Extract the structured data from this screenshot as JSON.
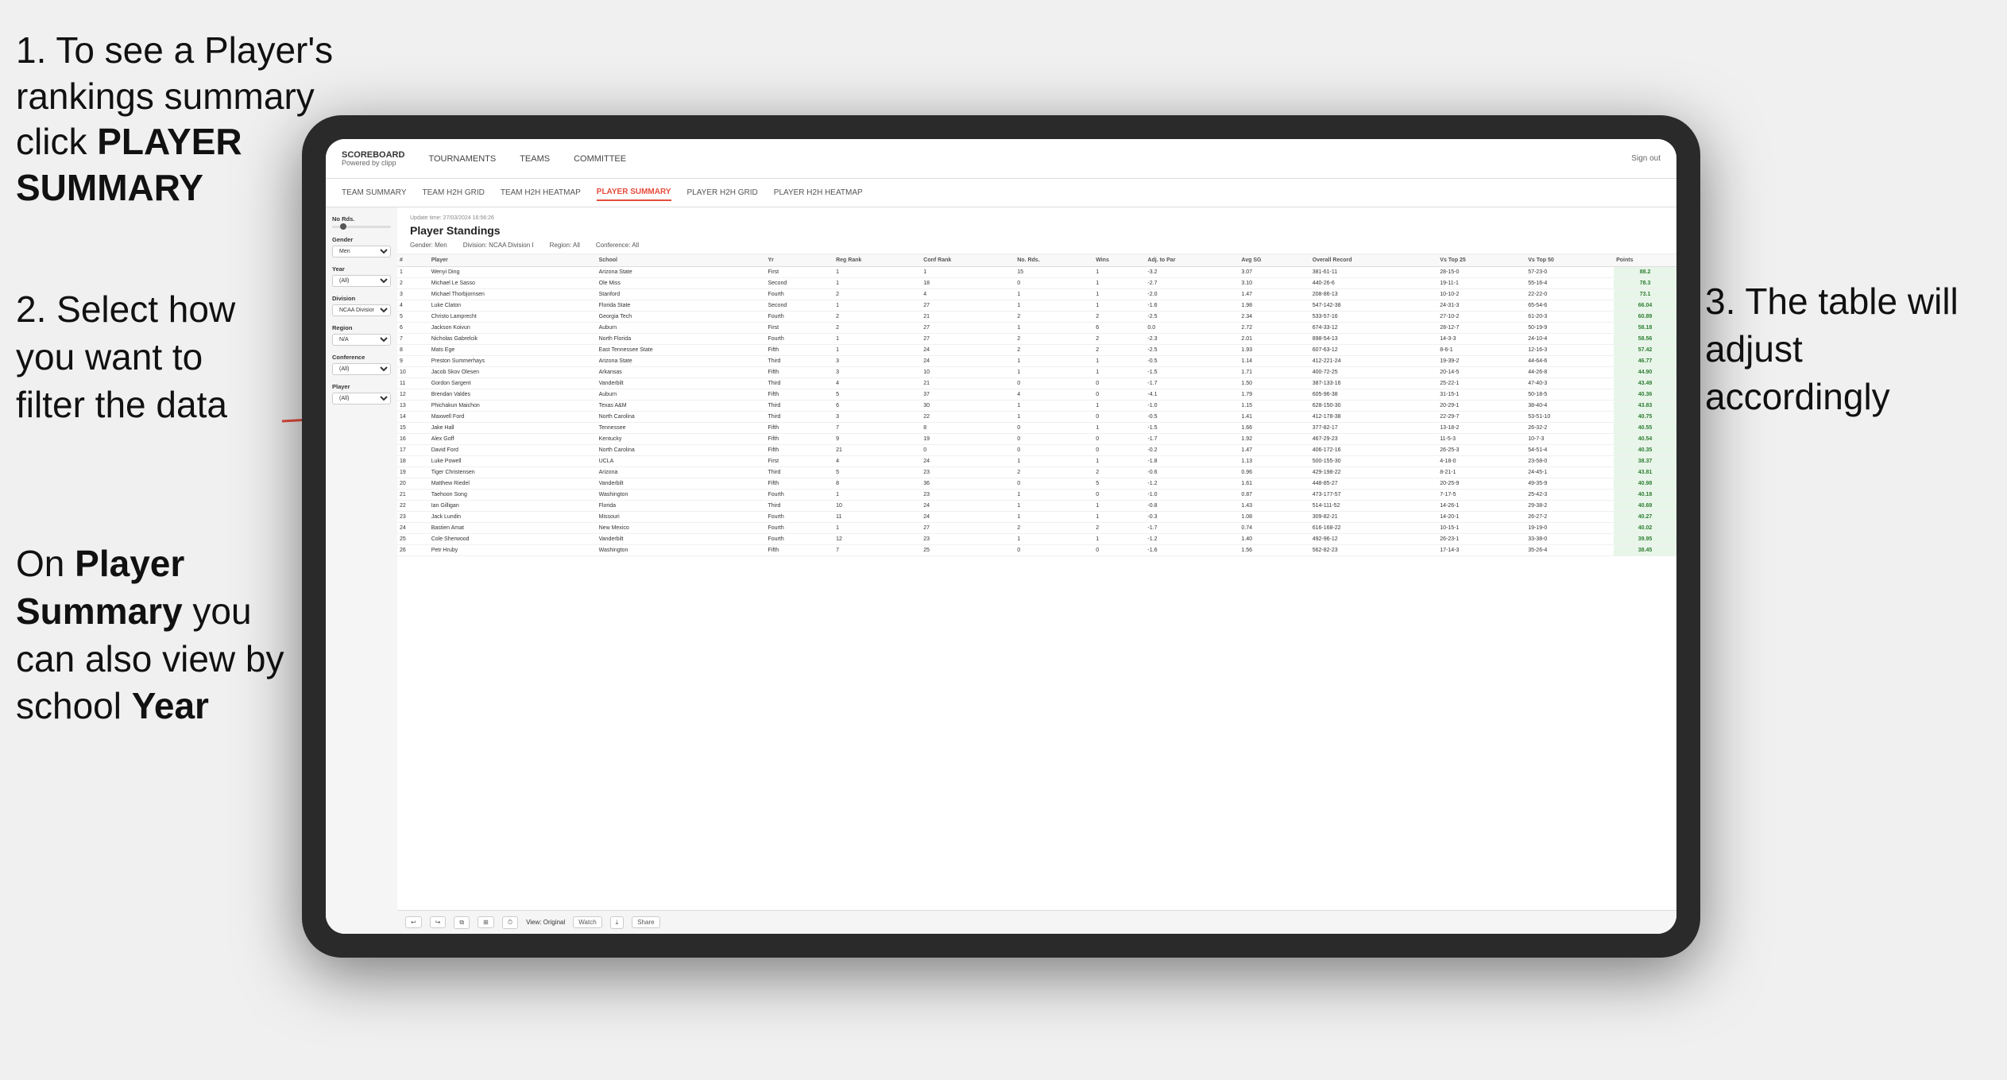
{
  "instructions": {
    "step1": "1. To see a Player's rankings summary click ",
    "step1_bold": "PLAYER SUMMARY",
    "step2_line1": "2. Select how you want to",
    "step2_line2": "filter the data",
    "step3_line1": "On ",
    "step3_bold1": "Player",
    "step3_line2": "Summary",
    "step3_line3": " you can also view by school ",
    "step3_bold2": "Year",
    "step4": "3. The table will adjust accordingly"
  },
  "header": {
    "logo": "SCOREBOARD",
    "logo_sub": "Powered by clipp",
    "nav": [
      "TOURNAMENTS",
      "TEAMS",
      "COMMITTEE"
    ],
    "sign_out": "Sign out"
  },
  "sub_nav": {
    "items": [
      "TEAM SUMMARY",
      "TEAM H2H GRID",
      "TEAM H2H HEATMAP",
      "PLAYER SUMMARY",
      "PLAYER H2H GRID",
      "PLAYER H2H HEATMAP"
    ],
    "active": "PLAYER SUMMARY"
  },
  "filters": {
    "no_rds_label": "No Rds.",
    "gender_label": "Gender",
    "gender_value": "Men",
    "year_label": "Year",
    "year_value": "(All)",
    "division_label": "Division",
    "division_value": "NCAA Division I",
    "region_label": "Region",
    "region_value": "N/A",
    "conference_label": "Conference",
    "conference_value": "(All)",
    "player_label": "Player",
    "player_value": "(All)"
  },
  "table": {
    "update_time": "Update time:",
    "update_date": "27/03/2024 16:56:26",
    "title": "Player Standings",
    "gender_label": "Gender:",
    "gender_val": "Men",
    "division_label": "Division:",
    "division_val": "NCAA Division I",
    "region_label": "Region:",
    "region_val": "All",
    "conference_label": "Conference:",
    "conference_val": "All",
    "columns": [
      "#",
      "Player",
      "School",
      "Yr",
      "Reg Rank",
      "Conf Rank",
      "No. Rds.",
      "Wins",
      "Adj. to Par",
      "Avg SG",
      "Overall Record",
      "Vs Top 25",
      "Vs Top 50",
      "Points"
    ],
    "rows": [
      {
        "rank": "1",
        "player": "Wenyi Ding",
        "school": "Arizona State",
        "yr": "First",
        "reg_rank": "1",
        "conf_rank": "1",
        "rds": "15",
        "wins": "1",
        "adj": "-3.2",
        "avg": "3.07",
        "record": "381-61-11",
        "vt25": "28-15-0",
        "vt50": "57-23-0",
        "points": "88.2"
      },
      {
        "rank": "2",
        "player": "Michael Le Sasso",
        "school": "Ole Miss",
        "yr": "Second",
        "reg_rank": "1",
        "conf_rank": "18",
        "rds": "0",
        "wins": "1",
        "adj": "-2.7",
        "avg": "3.10",
        "record": "440-26-6",
        "vt25": "19-11-1",
        "vt50": "55-16-4",
        "points": "78.3"
      },
      {
        "rank": "3",
        "player": "Michael Thorbjornsen",
        "school": "Stanford",
        "yr": "Fourth",
        "reg_rank": "2",
        "conf_rank": "4",
        "rds": "1",
        "wins": "1",
        "adj": "-2.0",
        "avg": "1.47",
        "record": "208-86-13",
        "vt25": "10-10-2",
        "vt50": "22-22-0",
        "points": "73.1"
      },
      {
        "rank": "4",
        "player": "Luke Claton",
        "school": "Florida State",
        "yr": "Second",
        "reg_rank": "1",
        "conf_rank": "27",
        "rds": "1",
        "wins": "1",
        "adj": "-1.6",
        "avg": "1.98",
        "record": "547-142-38",
        "vt25": "24-31-3",
        "vt50": "65-54-6",
        "points": "66.04"
      },
      {
        "rank": "5",
        "player": "Christo Lamprecht",
        "school": "Georgia Tech",
        "yr": "Fourth",
        "reg_rank": "2",
        "conf_rank": "21",
        "rds": "2",
        "wins": "2",
        "adj": "-2.5",
        "avg": "2.34",
        "record": "533-57-16",
        "vt25": "27-10-2",
        "vt50": "61-20-3",
        "points": "60.89"
      },
      {
        "rank": "6",
        "player": "Jackson Koivun",
        "school": "Auburn",
        "yr": "First",
        "reg_rank": "2",
        "conf_rank": "27",
        "rds": "1",
        "wins": "6",
        "adj": "0.0",
        "avg": "2.72",
        "record": "674-33-12",
        "vt25": "28-12-7",
        "vt50": "50-19-9",
        "points": "58.18"
      },
      {
        "rank": "7",
        "player": "Nicholas Gabrelcik",
        "school": "North Florida",
        "yr": "Fourth",
        "reg_rank": "1",
        "conf_rank": "27",
        "rds": "2",
        "wins": "2",
        "adj": "-2.3",
        "avg": "2.01",
        "record": "898-54-13",
        "vt25": "14-3-3",
        "vt50": "24-10-4",
        "points": "58.56"
      },
      {
        "rank": "8",
        "player": "Mats Ege",
        "school": "East Tennessee State",
        "yr": "Fifth",
        "reg_rank": "1",
        "conf_rank": "24",
        "rds": "2",
        "wins": "2",
        "adj": "-2.5",
        "avg": "1.93",
        "record": "607-63-12",
        "vt25": "8-6-1",
        "vt50": "12-16-3",
        "points": "57.42"
      },
      {
        "rank": "9",
        "player": "Preston Summerhays",
        "school": "Arizona State",
        "yr": "Third",
        "reg_rank": "3",
        "conf_rank": "24",
        "rds": "1",
        "wins": "1",
        "adj": "-0.5",
        "avg": "1.14",
        "record": "412-221-24",
        "vt25": "19-39-2",
        "vt50": "44-64-6",
        "points": "46.77"
      },
      {
        "rank": "10",
        "player": "Jacob Skov Olesen",
        "school": "Arkansas",
        "yr": "Fifth",
        "reg_rank": "3",
        "conf_rank": "10",
        "rds": "1",
        "wins": "1",
        "adj": "-1.5",
        "avg": "1.71",
        "record": "400-72-25",
        "vt25": "20-14-5",
        "vt50": "44-26-8",
        "points": "44.90"
      },
      {
        "rank": "11",
        "player": "Gordon Sargent",
        "school": "Vanderbilt",
        "yr": "Third",
        "reg_rank": "4",
        "conf_rank": "21",
        "rds": "0",
        "wins": "0",
        "adj": "-1.7",
        "avg": "1.50",
        "record": "387-133-16",
        "vt25": "25-22-1",
        "vt50": "47-40-3",
        "points": "43.49"
      },
      {
        "rank": "12",
        "player": "Brendan Valdes",
        "school": "Auburn",
        "yr": "Fifth",
        "reg_rank": "5",
        "conf_rank": "37",
        "rds": "4",
        "wins": "0",
        "adj": "-4.1",
        "avg": "1.79",
        "record": "605-96-38",
        "vt25": "31-15-1",
        "vt50": "50-18-5",
        "points": "40.36"
      },
      {
        "rank": "13",
        "player": "Phichakun Maichon",
        "school": "Texas A&M",
        "yr": "Third",
        "reg_rank": "6",
        "conf_rank": "30",
        "rds": "1",
        "wins": "1",
        "adj": "-1.0",
        "avg": "1.15",
        "record": "628-150-30",
        "vt25": "20-29-1",
        "vt50": "38-40-4",
        "points": "43.83"
      },
      {
        "rank": "14",
        "player": "Maxwell Ford",
        "school": "North Carolina",
        "yr": "Third",
        "reg_rank": "3",
        "conf_rank": "22",
        "rds": "1",
        "wins": "0",
        "adj": "-0.5",
        "avg": "1.41",
        "record": "412-178-38",
        "vt25": "22-29-7",
        "vt50": "53-51-10",
        "points": "40.75"
      },
      {
        "rank": "15",
        "player": "Jake Hall",
        "school": "Tennessee",
        "yr": "Fifth",
        "reg_rank": "7",
        "conf_rank": "8",
        "rds": "0",
        "wins": "1",
        "adj": "-1.5",
        "avg": "1.66",
        "record": "377-82-17",
        "vt25": "13-18-2",
        "vt50": "26-32-2",
        "points": "40.55"
      },
      {
        "rank": "16",
        "player": "Alex Goff",
        "school": "Kentucky",
        "yr": "Fifth",
        "reg_rank": "9",
        "conf_rank": "19",
        "rds": "0",
        "wins": "0",
        "adj": "-1.7",
        "avg": "1.92",
        "record": "467-29-23",
        "vt25": "11-5-3",
        "vt50": "10-7-3",
        "points": "40.54"
      },
      {
        "rank": "17",
        "player": "David Ford",
        "school": "North Carolina",
        "yr": "Fifth",
        "reg_rank": "21",
        "conf_rank": "0",
        "rds": "0",
        "wins": "0",
        "adj": "-0.2",
        "avg": "1.47",
        "record": "406-172-16",
        "vt25": "26-25-3",
        "vt50": "54-51-4",
        "points": "40.35"
      },
      {
        "rank": "18",
        "player": "Luke Powell",
        "school": "UCLA",
        "yr": "First",
        "reg_rank": "4",
        "conf_rank": "24",
        "rds": "1",
        "wins": "1",
        "adj": "-1.8",
        "avg": "1.13",
        "record": "500-155-30",
        "vt25": "4-18-0",
        "vt50": "23-58-0",
        "points": "38.37"
      },
      {
        "rank": "19",
        "player": "Tiger Christensen",
        "school": "Arizona",
        "yr": "Third",
        "reg_rank": "5",
        "conf_rank": "23",
        "rds": "2",
        "wins": "2",
        "adj": "-0.6",
        "avg": "0.96",
        "record": "429-198-22",
        "vt25": "8-21-1",
        "vt50": "24-45-1",
        "points": "43.81"
      },
      {
        "rank": "20",
        "player": "Matthew Riedel",
        "school": "Vanderbilt",
        "yr": "Fifth",
        "reg_rank": "8",
        "conf_rank": "36",
        "rds": "0",
        "wins": "5",
        "adj": "-1.2",
        "avg": "1.61",
        "record": "448-85-27",
        "vt25": "20-25-9",
        "vt50": "49-35-9",
        "points": "40.98"
      },
      {
        "rank": "21",
        "player": "Taehoon Song",
        "school": "Washington",
        "yr": "Fourth",
        "reg_rank": "1",
        "conf_rank": "23",
        "rds": "1",
        "wins": "0",
        "adj": "-1.0",
        "avg": "0.87",
        "record": "473-177-57",
        "vt25": "7-17-5",
        "vt50": "25-42-3",
        "points": "40.18"
      },
      {
        "rank": "22",
        "player": "Ian Gilligan",
        "school": "Florida",
        "yr": "Third",
        "reg_rank": "10",
        "conf_rank": "24",
        "rds": "1",
        "wins": "1",
        "adj": "-0.8",
        "avg": "1.43",
        "record": "514-111-52",
        "vt25": "14-26-1",
        "vt50": "29-38-2",
        "points": "40.69"
      },
      {
        "rank": "23",
        "player": "Jack Lundin",
        "school": "Missouri",
        "yr": "Fourth",
        "reg_rank": "11",
        "conf_rank": "24",
        "rds": "1",
        "wins": "1",
        "adj": "-0.3",
        "avg": "1.08",
        "record": "309-82-21",
        "vt25": "14-20-1",
        "vt50": "26-27-2",
        "points": "40.27"
      },
      {
        "rank": "24",
        "player": "Bastien Amat",
        "school": "New Mexico",
        "yr": "Fourth",
        "reg_rank": "1",
        "conf_rank": "27",
        "rds": "2",
        "wins": "2",
        "adj": "-1.7",
        "avg": "0.74",
        "record": "616-168-22",
        "vt25": "10-15-1",
        "vt50": "19-19-0",
        "points": "40.02"
      },
      {
        "rank": "25",
        "player": "Cole Sherwood",
        "school": "Vanderbilt",
        "yr": "Fourth",
        "reg_rank": "12",
        "conf_rank": "23",
        "rds": "1",
        "wins": "1",
        "adj": "-1.2",
        "avg": "1.40",
        "record": "492-96-12",
        "vt25": "26-23-1",
        "vt50": "33-38-0",
        "points": "39.95"
      },
      {
        "rank": "26",
        "player": "Petr Hruby",
        "school": "Washington",
        "yr": "Fifth",
        "reg_rank": "7",
        "conf_rank": "25",
        "rds": "0",
        "wins": "0",
        "adj": "-1.6",
        "avg": "1.56",
        "record": "562-82-23",
        "vt25": "17-14-3",
        "vt50": "35-26-4",
        "points": "38.45"
      }
    ]
  },
  "toolbar": {
    "view_label": "View: Original",
    "watch_label": "Watch",
    "share_label": "Share"
  }
}
